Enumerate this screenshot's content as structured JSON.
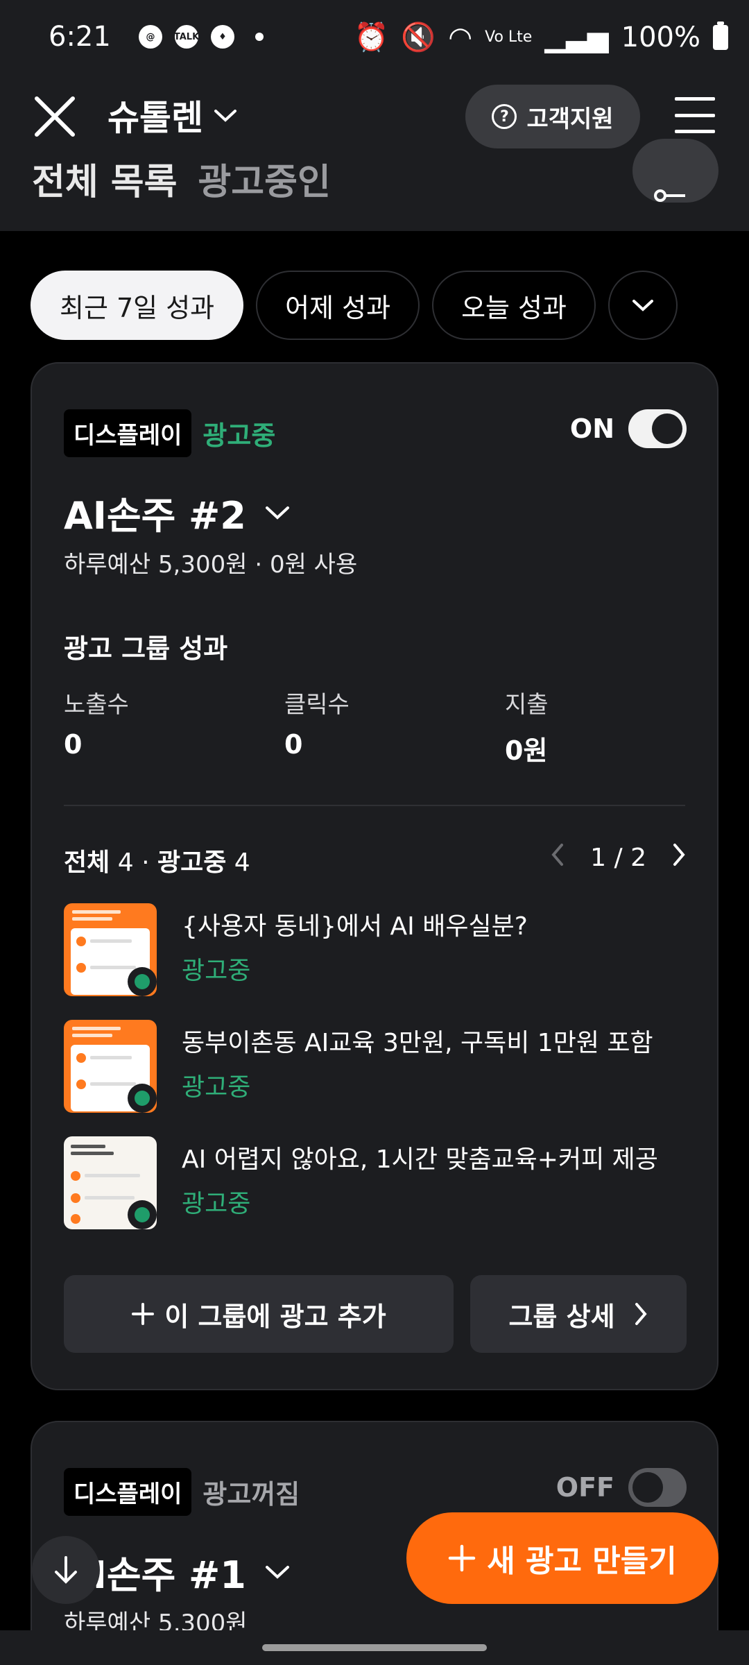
{
  "status_bar": {
    "time": "6:21",
    "talk_label": "TALK",
    "network": "Vo Lte",
    "battery": "100%"
  },
  "header": {
    "title": "슈톨렌",
    "support_label": "고객지원",
    "clipped_text": "전체 목록",
    "clipped_muted": "광고중인"
  },
  "chips": [
    "최근 7일 성과",
    "어제 성과",
    "오늘 성과"
  ],
  "campaign1": {
    "type": "디스플레이",
    "status": "광고중",
    "toggle_label": "ON",
    "name": "AI손주 #2",
    "budget": "하루예산 5,300원 · 0원 사용",
    "perf_title": "광고 그룹 성과",
    "metrics": [
      {
        "label": "노출수",
        "value": "0"
      },
      {
        "label": "클릭수",
        "value": "0"
      },
      {
        "label": "지출",
        "value": "0원"
      }
    ],
    "ads_total_label": "전체",
    "ads_total": "4",
    "ads_live_label": "광고중",
    "ads_live": "4",
    "pager": "1 / 2",
    "ads": [
      {
        "title": "{사용자 동네}에서 AI 배우실분?",
        "status": "광고중"
      },
      {
        "title": "동부이촌동 AI교육 3만원, 구독비 1만원 포함",
        "status": "광고중"
      },
      {
        "title": "AI 어렵지 않아요, 1시간 맞춤교육+커피 제공",
        "status": "광고중"
      }
    ],
    "add_button": "이 그룹에 광고 추가",
    "detail_button": "그룹 상세"
  },
  "campaign2": {
    "type": "디스플레이",
    "status": "광고꺼짐",
    "toggle_label": "OFF",
    "name": "AI손주 #1",
    "budget": "하루예산 5,300원"
  },
  "fab_label": "새 광고 만들기",
  "colors": {
    "accent": "#ff6a0d",
    "live": "#2fae78",
    "card": "#1c1d20"
  }
}
